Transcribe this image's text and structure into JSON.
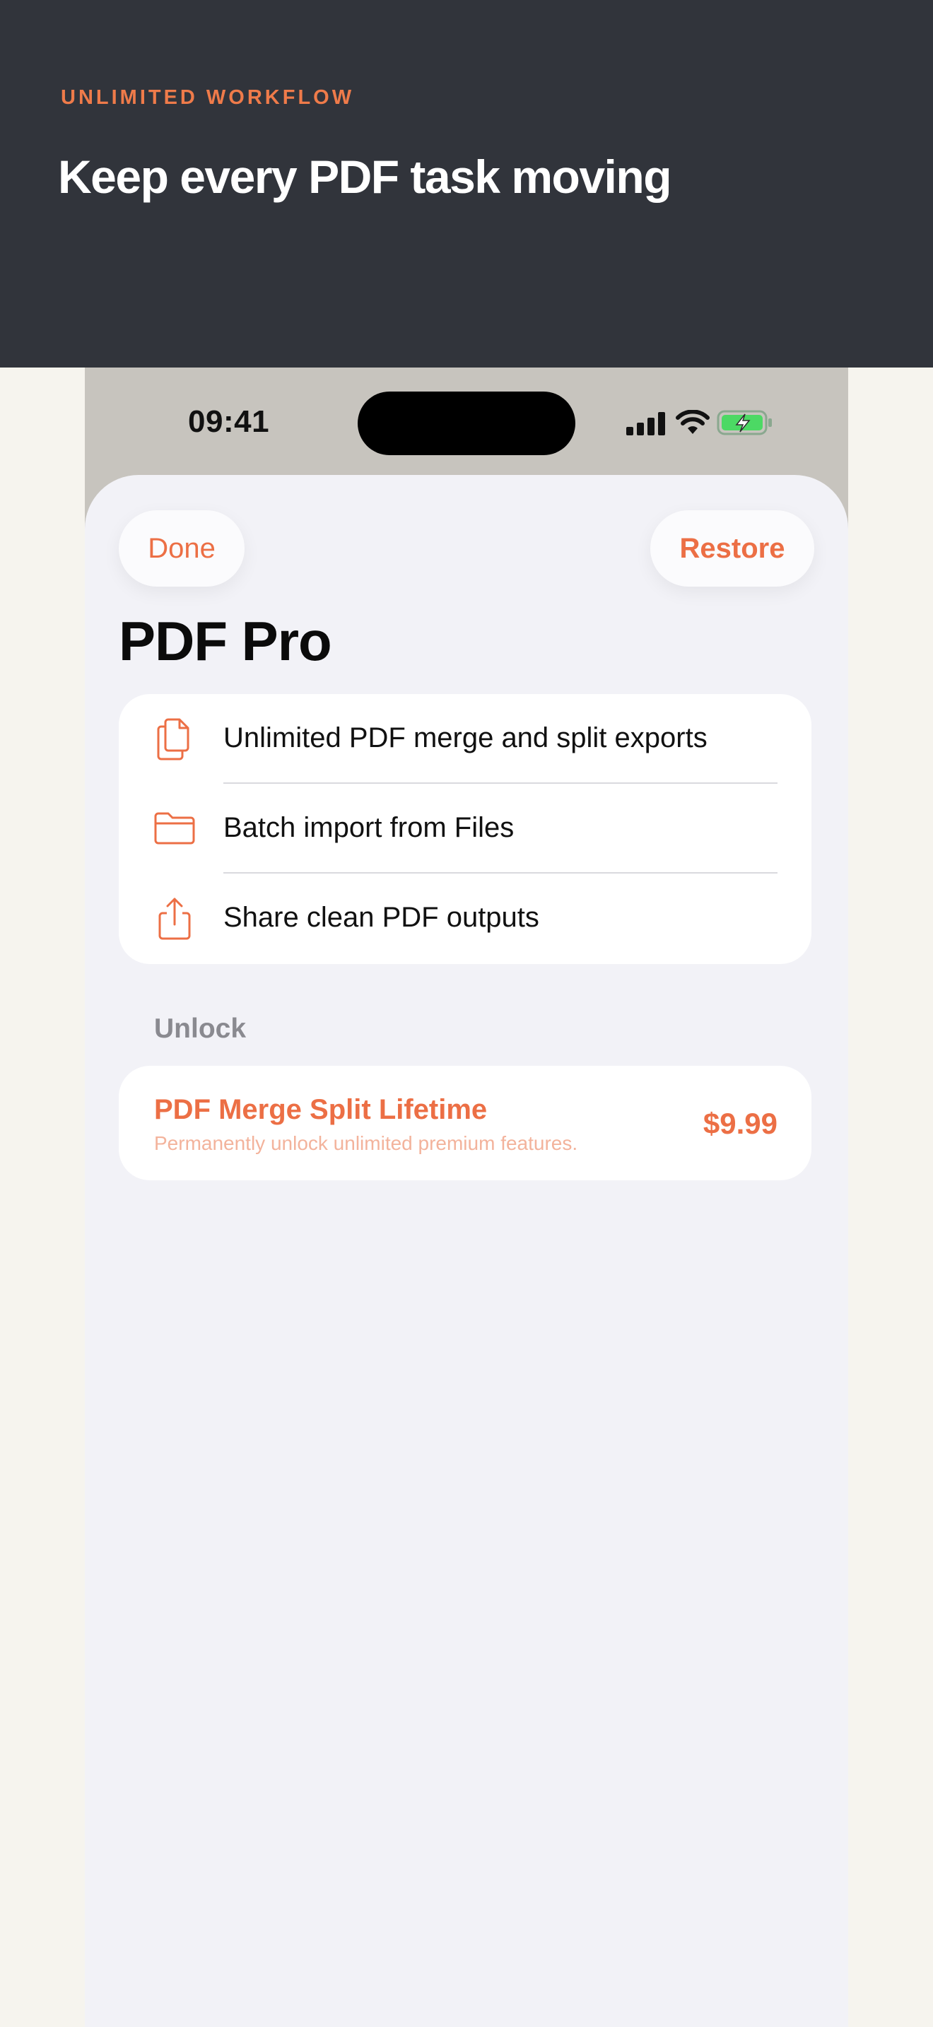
{
  "banner": {
    "eyebrow": "UNLIMITED WORKFLOW",
    "headline": "Keep every PDF task moving"
  },
  "status_bar": {
    "time": "09:41",
    "icons": [
      "cellular-signal-icon",
      "wifi-icon",
      "battery-charging-icon"
    ]
  },
  "nav": {
    "done_label": "Done",
    "restore_label": "Restore"
  },
  "sheet": {
    "title": "PDF Pro"
  },
  "features": [
    {
      "icon": "documents-icon",
      "label": "Unlimited PDF merge and split exports"
    },
    {
      "icon": "folder-icon",
      "label": "Batch import from Files"
    },
    {
      "icon": "share-icon",
      "label": "Share clean PDF outputs"
    }
  ],
  "unlock": {
    "section_label": "Unlock",
    "product_name": "PDF Merge Split Lifetime",
    "product_description": "Permanently unlock unlimited premium features.",
    "price": "$9.99"
  },
  "colors": {
    "accent": "#ec6f45",
    "banner_bg": "#31343b",
    "page_bg": "#f6f4ee",
    "sheet_bg": "#f2f2f7",
    "battery_green": "#4cd964"
  }
}
